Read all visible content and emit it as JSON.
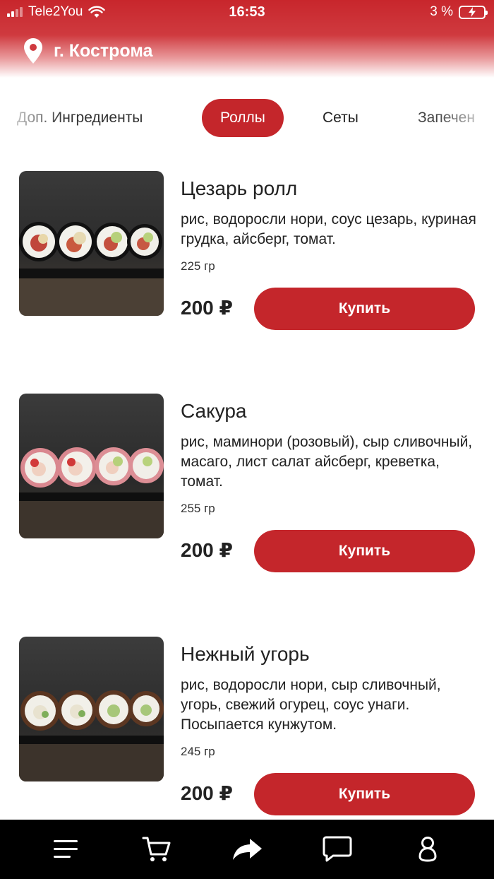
{
  "status_bar": {
    "carrier": "Tele2You",
    "time": "16:53",
    "battery_percent": "3 %"
  },
  "location": {
    "city": "г. Кострома",
    "icon": "map-pin-icon"
  },
  "tabs": [
    {
      "label": "Доп. Ингредиенты",
      "active": false
    },
    {
      "label": "Роллы",
      "active": true
    },
    {
      "label": "Сеты",
      "active": false
    },
    {
      "label": "Запечен",
      "active": false
    }
  ],
  "products": [
    {
      "name": "Цезарь ролл",
      "description": "рис, водоросли нори, соус цезарь, куриная грудка, айсберг, томат.",
      "weight": "225 гр",
      "price": "200 ₽",
      "buy_label": "Купить"
    },
    {
      "name": "Сакура",
      "description": "рис, маминори (розовый), сыр сливочный, масаго, лист салат айсберг, креветка, томат.",
      "weight": "255 гр",
      "price": "200 ₽",
      "buy_label": "Купить"
    },
    {
      "name": "Нежный угорь",
      "description": "рис, водоросли нори, сыр сливочный, угорь, свежий огурец, соус унаги. Посыпается кунжутом.",
      "weight": "245 гр",
      "price": "200 ₽",
      "buy_label": "Купить"
    }
  ],
  "bottom_nav": [
    "menu-icon",
    "cart-icon",
    "share-icon",
    "chat-icon",
    "profile-icon"
  ],
  "colors": {
    "accent": "#c4262b",
    "nav_background": "#000000"
  }
}
